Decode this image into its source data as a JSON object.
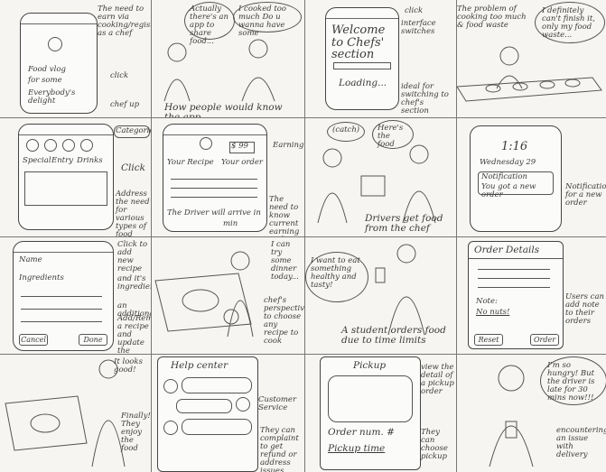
{
  "panels": {
    "p1": {
      "note_chef": "The need to earn via cooking/register as a chef",
      "note_click": "click",
      "note_chef_up": "chef up",
      "phone_text_1": "Food vlog",
      "phone_text_2": "for some",
      "phone_text_3": "Everybody's delight"
    },
    "p2": {
      "bubble_1": "Actually there's an app to share food...",
      "bubble_2": "I cooked too much Do u wanna have some",
      "caption": "How people would know the app"
    },
    "p3": {
      "welcome": "Welcome to Chefs' section",
      "loading": "Loading...",
      "note_click": "click",
      "note_interface": "interface switches",
      "note_ideal": "ideal for switching to chef's section"
    },
    "p4": {
      "note_problem": "The problem of cooking too much & food waste",
      "bubble": "I definitely can't finish it, only my food waste..."
    },
    "p5": {
      "tab": "Categories",
      "tab_1": "Special",
      "tab_2": "Entry",
      "tab_3": "Drinks",
      "note_click": "Click",
      "note_address": "Address the need for various types of food"
    },
    "p6": {
      "your_recipe": "Your Recipe",
      "your_order": "Your order",
      "earning_sign": "$ 99",
      "earning_label": "Earning",
      "driver": "The Driver will arrive in",
      "driver_unit": "min",
      "note_need": "The need to know current earning and other information as a chef"
    },
    "p7": {
      "bubble_1": "(catch)",
      "bubble_2": "Here's the food",
      "caption": "Drivers get food from the chef"
    },
    "p8": {
      "time": "1:16",
      "date": "Wednesday 29",
      "notif_title": "Notification",
      "notif_body": "You got a new order",
      "note": "Notification for a new order"
    },
    "p9": {
      "field_1": "Name",
      "field_2": "Ingredients",
      "btn_1": "Cancel",
      "btn_2": "Done",
      "note_click": "Click to add new recipe",
      "note_ingredients": "and it's ingredients",
      "note_additional": "an additional",
      "note_add": "Add/Remove a recipe and update the ingredients"
    },
    "p10": {
      "bubble": "I can try some dinner today...",
      "note": "chef's perspective to choose any recipe to cook"
    },
    "p11": {
      "bubble": "I want to eat something healthy and tasty!",
      "caption": "A student orders food due to time limits"
    },
    "p12": {
      "title": "Order Details",
      "note_label": "Note:",
      "note_value": "No nuts!",
      "btn_1": "Reset",
      "btn_2": "Order",
      "side_note": "Users can add note to their orders"
    },
    "p13": {
      "bubble": "It looks good!",
      "note": "Finally! They enjoy the food"
    },
    "p14": {
      "title": "Help center",
      "label": "Customer Service",
      "note": "They can complaint to get refund or address issues"
    },
    "p15": {
      "title": "Pickup",
      "order": "Order num. #",
      "pickup_time": "Pickup time",
      "note_view": "view the detail of a pickup order",
      "note_choose": "They can choose pickup"
    },
    "p16": {
      "bubble": "I'm so hungry! But the driver is late for 30 mins now!!!",
      "note": "encountering an issue with delivery"
    }
  }
}
